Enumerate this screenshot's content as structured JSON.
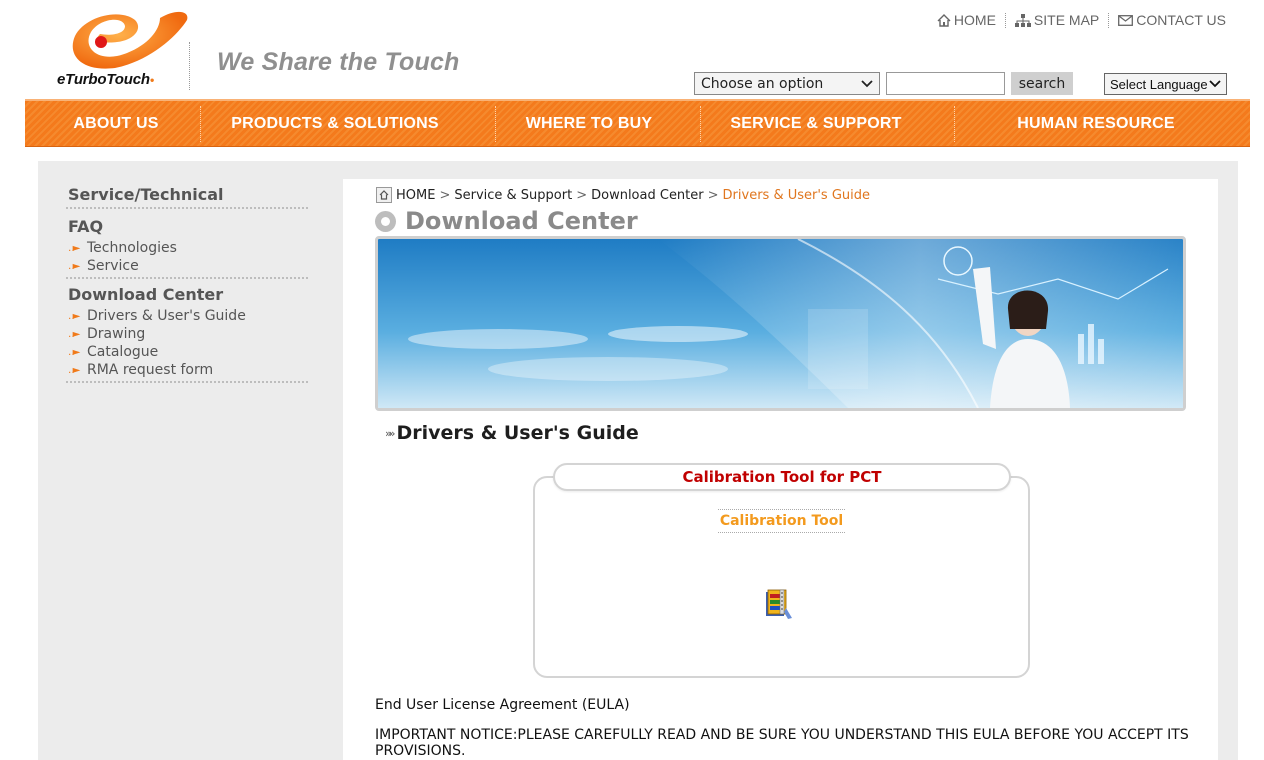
{
  "brand": {
    "logo_text": "eTurboTouch",
    "slogan": "We Share the Touch",
    "accent_color": "#f47a1c"
  },
  "toplinks": {
    "home": "HOME",
    "sitemap": "SITE MAP",
    "contact": "CONTACT US"
  },
  "search": {
    "select_value": "Choose an option",
    "input_value": "",
    "button_label": "search"
  },
  "language": {
    "select_value": "Select Language"
  },
  "nav": {
    "items": [
      {
        "label": "ABOUT US"
      },
      {
        "label": "PRODUCTS & SOLUTIONS"
      },
      {
        "label": "WHERE TO BUY"
      },
      {
        "label": "SERVICE & SUPPORT"
      },
      {
        "label": "HUMAN RESOURCE"
      }
    ]
  },
  "sidebar": {
    "title": "Service/Technical",
    "groups": [
      {
        "title": "FAQ",
        "items": [
          {
            "label": "Technologies"
          },
          {
            "label": "Service"
          }
        ]
      },
      {
        "title": "Download Center",
        "items": [
          {
            "label": "Drivers & User's Guide"
          },
          {
            "label": "Drawing"
          },
          {
            "label": "Catalogue"
          },
          {
            "label": "RMA request form"
          }
        ]
      }
    ]
  },
  "breadcrumb": {
    "home": "HOME",
    "level1": "Service & Support",
    "level2": "Download Center",
    "current": "Drivers & User's Guide"
  },
  "page": {
    "title": "Download Center",
    "section_title": "Drivers & User's Guide"
  },
  "tool": {
    "header": "Calibration Tool for PCT",
    "link": "Calibration Tool",
    "icon": "zip-archive-icon"
  },
  "eula": {
    "title": "End User License Agreement (EULA)",
    "notice": "IMPORTANT NOTICE:PLEASE CAREFULLY READ AND BE SURE YOU UNDERSTAND THIS EULA BEFORE YOU ACCEPT ITS PROVISIONS."
  }
}
